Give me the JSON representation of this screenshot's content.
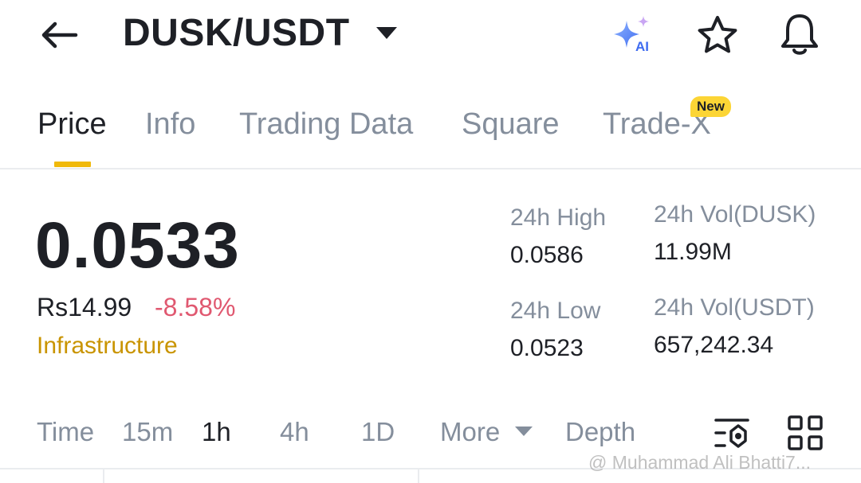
{
  "header": {
    "pair": "DUSK/USDT",
    "icons": {
      "back": "arrow-left-icon",
      "pair_dropdown": "caret-down-icon",
      "ai": "ai-sparkle-icon",
      "favorite": "star-icon",
      "alerts": "bell-icon"
    },
    "ai_label": "AI"
  },
  "tabs": [
    {
      "label": "Price",
      "active": true
    },
    {
      "label": "Info"
    },
    {
      "label": "Trading Data"
    },
    {
      "label": "Square"
    },
    {
      "label": "Trade-X",
      "badge": "New"
    }
  ],
  "price": {
    "last": "0.0533",
    "fiat": "Rs14.99",
    "change": "-8.58%",
    "category": "Infrastructure"
  },
  "stats": {
    "high_label": "24h High",
    "high_value": "0.0586",
    "low_label": "24h Low",
    "low_value": "0.0523",
    "vol_base_label": "24h Vol(DUSK)",
    "vol_base_value": "11.99M",
    "vol_quote_label": "24h Vol(USDT)",
    "vol_quote_value": "657,242.34"
  },
  "intervals": {
    "items": [
      "Time",
      "15m",
      "1h",
      "4h",
      "1D",
      "More",
      "Depth"
    ],
    "active": "1h",
    "tools": [
      "indicator-settings-icon",
      "layout-grid-icon"
    ]
  },
  "watermark": "@ Muhammad Ali Bhatti7...",
  "colors": {
    "accent": "#f0b90b",
    "badge": "#fcd535",
    "negative": "#e05870",
    "category": "#c99400",
    "muted": "#848e9c",
    "text": "#1e2026"
  }
}
